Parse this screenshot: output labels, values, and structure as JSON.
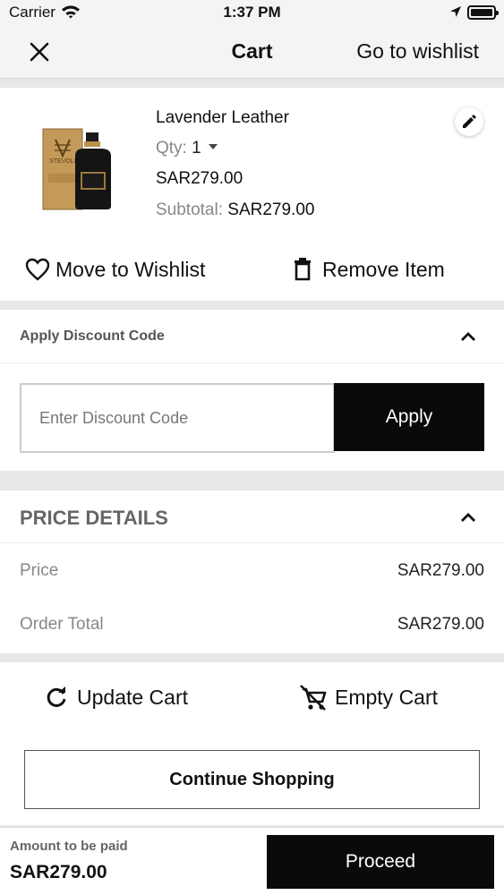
{
  "status_bar": {
    "carrier": "Carrier",
    "time": "1:37 PM"
  },
  "nav": {
    "title": "Cart",
    "wishlist_link": "Go to wishlist"
  },
  "cart_item": {
    "name": "Lavender Leather",
    "qty_label": "Qty:",
    "qty_value": "1",
    "price": "SAR279.00",
    "subtotal_label": "Subtotal:",
    "subtotal_value": "SAR279.00",
    "move_to_wishlist": "Move to Wishlist",
    "remove_item": "Remove Item"
  },
  "discount": {
    "title": "Apply Discount Code",
    "placeholder": "Enter Discount Code",
    "apply_label": "Apply"
  },
  "price_details": {
    "title": "PRICE DETAILS",
    "rows": [
      {
        "label": "Price",
        "value": "SAR279.00"
      },
      {
        "label": "Order Total",
        "value": "SAR279.00"
      }
    ]
  },
  "actions": {
    "update_cart": "Update Cart",
    "empty_cart": "Empty Cart",
    "continue_shopping": "Continue Shopping"
  },
  "footer": {
    "amount_label": "Amount to be paid",
    "amount_value": "SAR279.00",
    "proceed_label": "Proceed"
  },
  "colors": {
    "primary_button": "#0a0a0a",
    "page_background": "#e8e8ea",
    "card": "#ffffff",
    "muted_text": "#888888"
  }
}
